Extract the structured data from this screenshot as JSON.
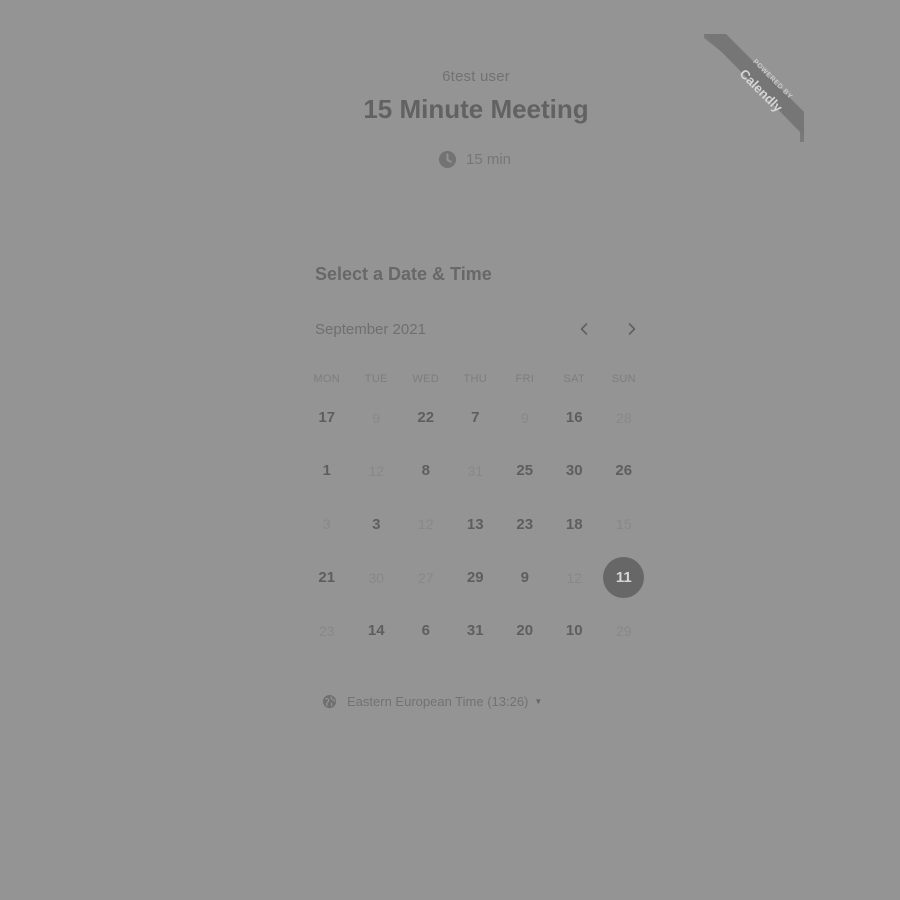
{
  "event": {
    "owner": "6test user",
    "title": "15 Minute Meeting",
    "duration": "15 min"
  },
  "branding": {
    "line1": "POWERED BY",
    "line2": "Calendly"
  },
  "picker": {
    "section_title": "Select a Date & Time",
    "month_label": "September 2021",
    "weekdays": [
      "MON",
      "TUE",
      "WED",
      "THU",
      "FRI",
      "SAT",
      "SUN"
    ],
    "weeks": [
      [
        {
          "d": "17",
          "s": "available"
        },
        {
          "d": "9",
          "s": "unavailable"
        },
        {
          "d": "22",
          "s": "available"
        },
        {
          "d": "7",
          "s": "available"
        },
        {
          "d": "9",
          "s": "unavailable"
        },
        {
          "d": "16",
          "s": "available"
        },
        {
          "d": "28",
          "s": "unavailable"
        }
      ],
      [
        {
          "d": "1",
          "s": "available"
        },
        {
          "d": "12",
          "s": "unavailable"
        },
        {
          "d": "8",
          "s": "available"
        },
        {
          "d": "31",
          "s": "unavailable"
        },
        {
          "d": "25",
          "s": "available"
        },
        {
          "d": "30",
          "s": "available"
        },
        {
          "d": "26",
          "s": "available"
        }
      ],
      [
        {
          "d": "3",
          "s": "unavailable"
        },
        {
          "d": "3",
          "s": "available"
        },
        {
          "d": "12",
          "s": "unavailable"
        },
        {
          "d": "13",
          "s": "available"
        },
        {
          "d": "23",
          "s": "available"
        },
        {
          "d": "18",
          "s": "available"
        },
        {
          "d": "15",
          "s": "unavailable"
        }
      ],
      [
        {
          "d": "21",
          "s": "available"
        },
        {
          "d": "30",
          "s": "unavailable"
        },
        {
          "d": "27",
          "s": "unavailable"
        },
        {
          "d": "29",
          "s": "available"
        },
        {
          "d": "9",
          "s": "available"
        },
        {
          "d": "12",
          "s": "unavailable"
        },
        {
          "d": "11",
          "s": "selected"
        }
      ],
      [
        {
          "d": "23",
          "s": "unavailable"
        },
        {
          "d": "14",
          "s": "available"
        },
        {
          "d": "6",
          "s": "available"
        },
        {
          "d": "31",
          "s": "available"
        },
        {
          "d": "20",
          "s": "available"
        },
        {
          "d": "10",
          "s": "available"
        },
        {
          "d": "29",
          "s": "unavailable"
        }
      ]
    ]
  },
  "timezone": {
    "label": "Eastern European Time (13:26)"
  },
  "icons": {
    "duration": "clock-icon",
    "prev": "chevron-left-icon",
    "next": "chevron-right-icon",
    "timezone": "globe-icon",
    "timezone_caret": "caret-down-icon"
  },
  "colors": {
    "background": "#949494",
    "selected_day": "#676767",
    "text_dark": "#5e5e5e"
  }
}
